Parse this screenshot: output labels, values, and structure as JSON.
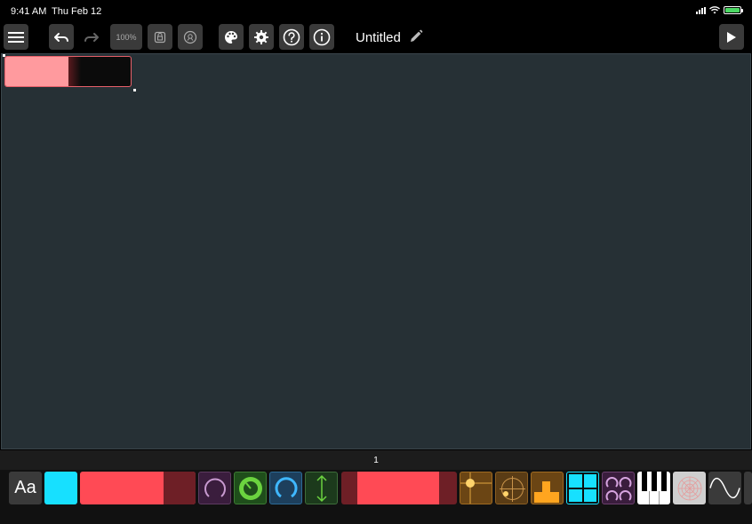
{
  "status_bar": {
    "time": "9:41 AM",
    "date": "Thu Feb 12",
    "battery_color": "#4cd964"
  },
  "toolbar": {
    "menu_icon": "hamburger-menu-icon",
    "undo_icon": "undo-icon",
    "redo_icon": "redo-icon",
    "zoom_label": "100%",
    "lock_icon": "lock-icon",
    "link_icon": "link-icon",
    "palette_icon": "palette-icon",
    "settings_icon": "gear-icon",
    "help_icon": "question-icon",
    "info_icon": "info-icon",
    "title": "Untitled",
    "edit_icon": "pencil-icon",
    "play_icon": "play-icon"
  },
  "canvas": {
    "background": "#263035",
    "slider_widget": {
      "value": 0.5,
      "fill_color": "#ff9a9e",
      "border_color": "#e8606a"
    }
  },
  "pager": {
    "current_page": "1"
  },
  "widget_palette": {
    "text_label": "Aa",
    "items": [
      "text-widget",
      "button-widget",
      "fader-widget",
      "knob-widget",
      "encoder-widget",
      "radial-widget",
      "vertical-fader-widget",
      "range-widget",
      "xy-pad-widget",
      "radial-xy-widget",
      "multi-fader-widget",
      "pad-grid-widget",
      "multi-knob-widget",
      "keyboard-widget",
      "radar-widget",
      "waveform-widget",
      "more-widget"
    ],
    "accent_teal": "#17e0ff",
    "accent_red": "#ff4a55"
  }
}
